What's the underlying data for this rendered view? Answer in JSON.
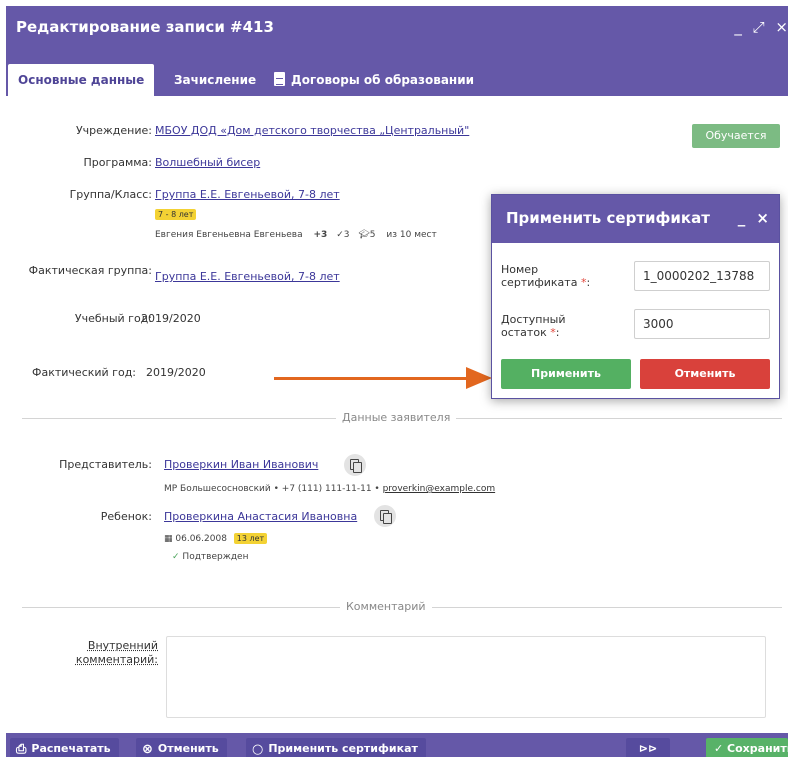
{
  "window": {
    "title": "Редактирование записи #413",
    "minimize": "_",
    "maximize": "⤢",
    "close": "×"
  },
  "tabs": [
    {
      "label": "Основные данные"
    },
    {
      "label": "Зачисление"
    },
    {
      "label": "Договоры об образовании"
    }
  ],
  "fields": {
    "institution_label": "Учреждение:",
    "institution_value": "МБОУ ДОД «Дом детского творчества „Центральный\"",
    "program_label": "Программа:",
    "program_value": "Волшебный бисер",
    "group_label": "Группа/Класс:",
    "group_value": "Группа Е.Е. Евгеньевой, 7-8 лет",
    "age_badge": "7 - 8 лет",
    "teacher_info": "Евгения Евгеньевна Евгеньева",
    "stat_plus": "+3",
    "stat_check": "✓3",
    "stat_grad": "5",
    "stat_places": "из 10 мест",
    "actual_group_label": "Фактическая группа:",
    "actual_group_value": "Группа Е.Е. Евгеньевой, 7-8 лет",
    "study_year_label": "Учебный год:",
    "study_year_value": "2019/2020",
    "actual_year_label": "Фактический год:",
    "actual_year_value": "2019/2020"
  },
  "status": {
    "label": "Обучается",
    "color": "#7cbb83"
  },
  "applicant": {
    "section_title": "Данные заявителя",
    "rep_label": "Представитель:",
    "rep_name": "Проверкин Иван Иванович",
    "rep_details": "МР Большесосновский • +7 (111) 111-11-11 •",
    "rep_email": "proverkin@example.com",
    "child_label": "Ребенок:",
    "child_name": "Проверкина Анастасия Ивановна",
    "child_birth": "06.06.2008",
    "child_age": "13 лет",
    "child_status": "Подтвержден"
  },
  "comment": {
    "section_title": "Комментарий",
    "internal_label": "Внутренний комментарий:",
    "value": ""
  },
  "dialog": {
    "title": "Применить сертификат",
    "minimize": "_",
    "close": "×",
    "cert_label": "Номер сертификата",
    "cert_value": "1_0000202_13788",
    "balance_label": "Доступный остаток",
    "balance_value": "3000",
    "required_mark": "*",
    "colon": ":",
    "apply_label": "Применить",
    "cancel_label": "Отменить",
    "apply_color": "#54b062",
    "cancel_color": "#d9413b"
  },
  "footer": {
    "print_label": "Распечатать",
    "cancel_label": "Отменить",
    "apply_cert_label": "Применить сертификат",
    "next_label": "⊳⊳",
    "save_label": "✓ Сохранить"
  },
  "colors": {
    "header": "#6558a8",
    "link": "#3c3799",
    "arrow": "#e2671f"
  }
}
